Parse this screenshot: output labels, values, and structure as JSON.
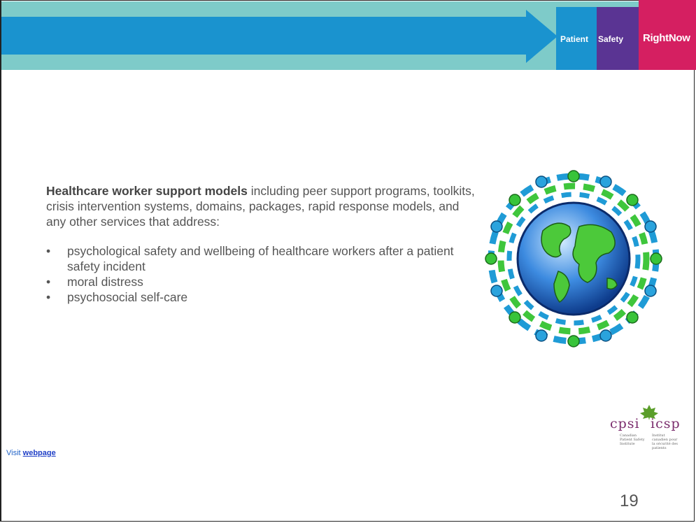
{
  "header": {
    "badge_patient": "Patient",
    "badge_safety": "Safety",
    "badge_rightnow": "RightNow"
  },
  "colors": {
    "banner_teal": "#7ecbc9",
    "arrow_blue": "#1a93cf",
    "patient_blue": "#1a93cf",
    "safety_purple": "#5a3493",
    "rightnow_pink": "#d51f61"
  },
  "content": {
    "lead_bold": "Healthcare worker support models",
    "lead_rest": " including peer support programs, toolkits, crisis intervention systems, domains, packages, rapid response models, and any other services that address:",
    "bullets": [
      "psychological safety and wellbeing of healthcare workers after a patient safety incident",
      "moral distress",
      "psychosocial self-care"
    ],
    "bullet_glyph": "•"
  },
  "footer": {
    "visit_text": "Visit",
    "link_text": "webpage",
    "page_number": "19"
  },
  "logo": {
    "cpsi_word": "cpsi",
    "icsp_word": "icsp",
    "en_lines": "Canadian Patient Safety Institute",
    "fr_lines": "Institut canadien pour la sécurité des patients"
  },
  "image": {
    "icon": "globe-with-people-chain-icon"
  }
}
